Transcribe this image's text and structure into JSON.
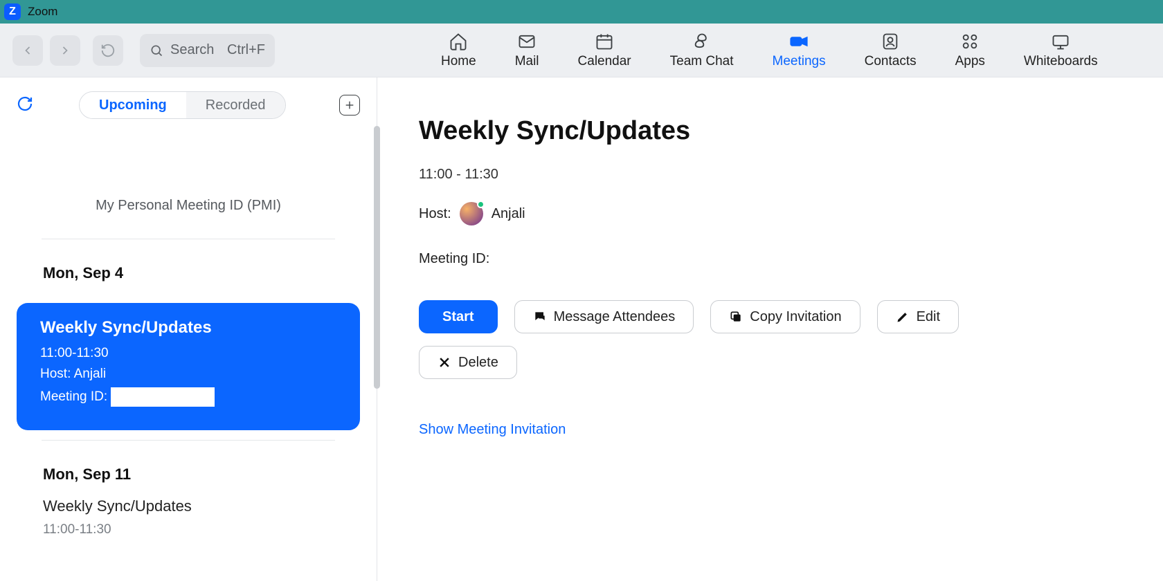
{
  "window": {
    "title": "Zoom"
  },
  "toolbar": {
    "search_placeholder": "Search",
    "search_shortcut": "Ctrl+F"
  },
  "nav_tabs": [
    {
      "label": "Home",
      "active": false
    },
    {
      "label": "Mail",
      "active": false
    },
    {
      "label": "Calendar",
      "active": false
    },
    {
      "label": "Team Chat",
      "active": false
    },
    {
      "label": "Meetings",
      "active": true
    },
    {
      "label": "Contacts",
      "active": false
    },
    {
      "label": "Apps",
      "active": false
    },
    {
      "label": "Whiteboards",
      "active": false
    }
  ],
  "sidebar": {
    "segmented": {
      "upcoming": "Upcoming",
      "recorded": "Recorded"
    },
    "pmi_label": "My Personal Meeting ID (PMI)",
    "groups": [
      {
        "date": "Mon, Sep 4",
        "items": [
          {
            "title": "Weekly Sync/Updates",
            "time": "11:00-11:30",
            "host_line": "Host: Anjali",
            "meeting_id_label": "Meeting ID:",
            "selected": true
          }
        ]
      },
      {
        "date": "Mon, Sep 11",
        "items": [
          {
            "title": "Weekly Sync/Updates",
            "time": "11:00-11:30",
            "selected": false
          }
        ]
      }
    ]
  },
  "detail": {
    "title": "Weekly Sync/Updates",
    "time": "11:00 - 11:30",
    "host_label": "Host:",
    "host_name": "Anjali",
    "meeting_id_label": "Meeting ID:",
    "actions": {
      "start": "Start",
      "message": "Message Attendees",
      "copy": "Copy Invitation",
      "edit": "Edit",
      "delete": "Delete"
    },
    "show_invitation": "Show Meeting Invitation"
  }
}
